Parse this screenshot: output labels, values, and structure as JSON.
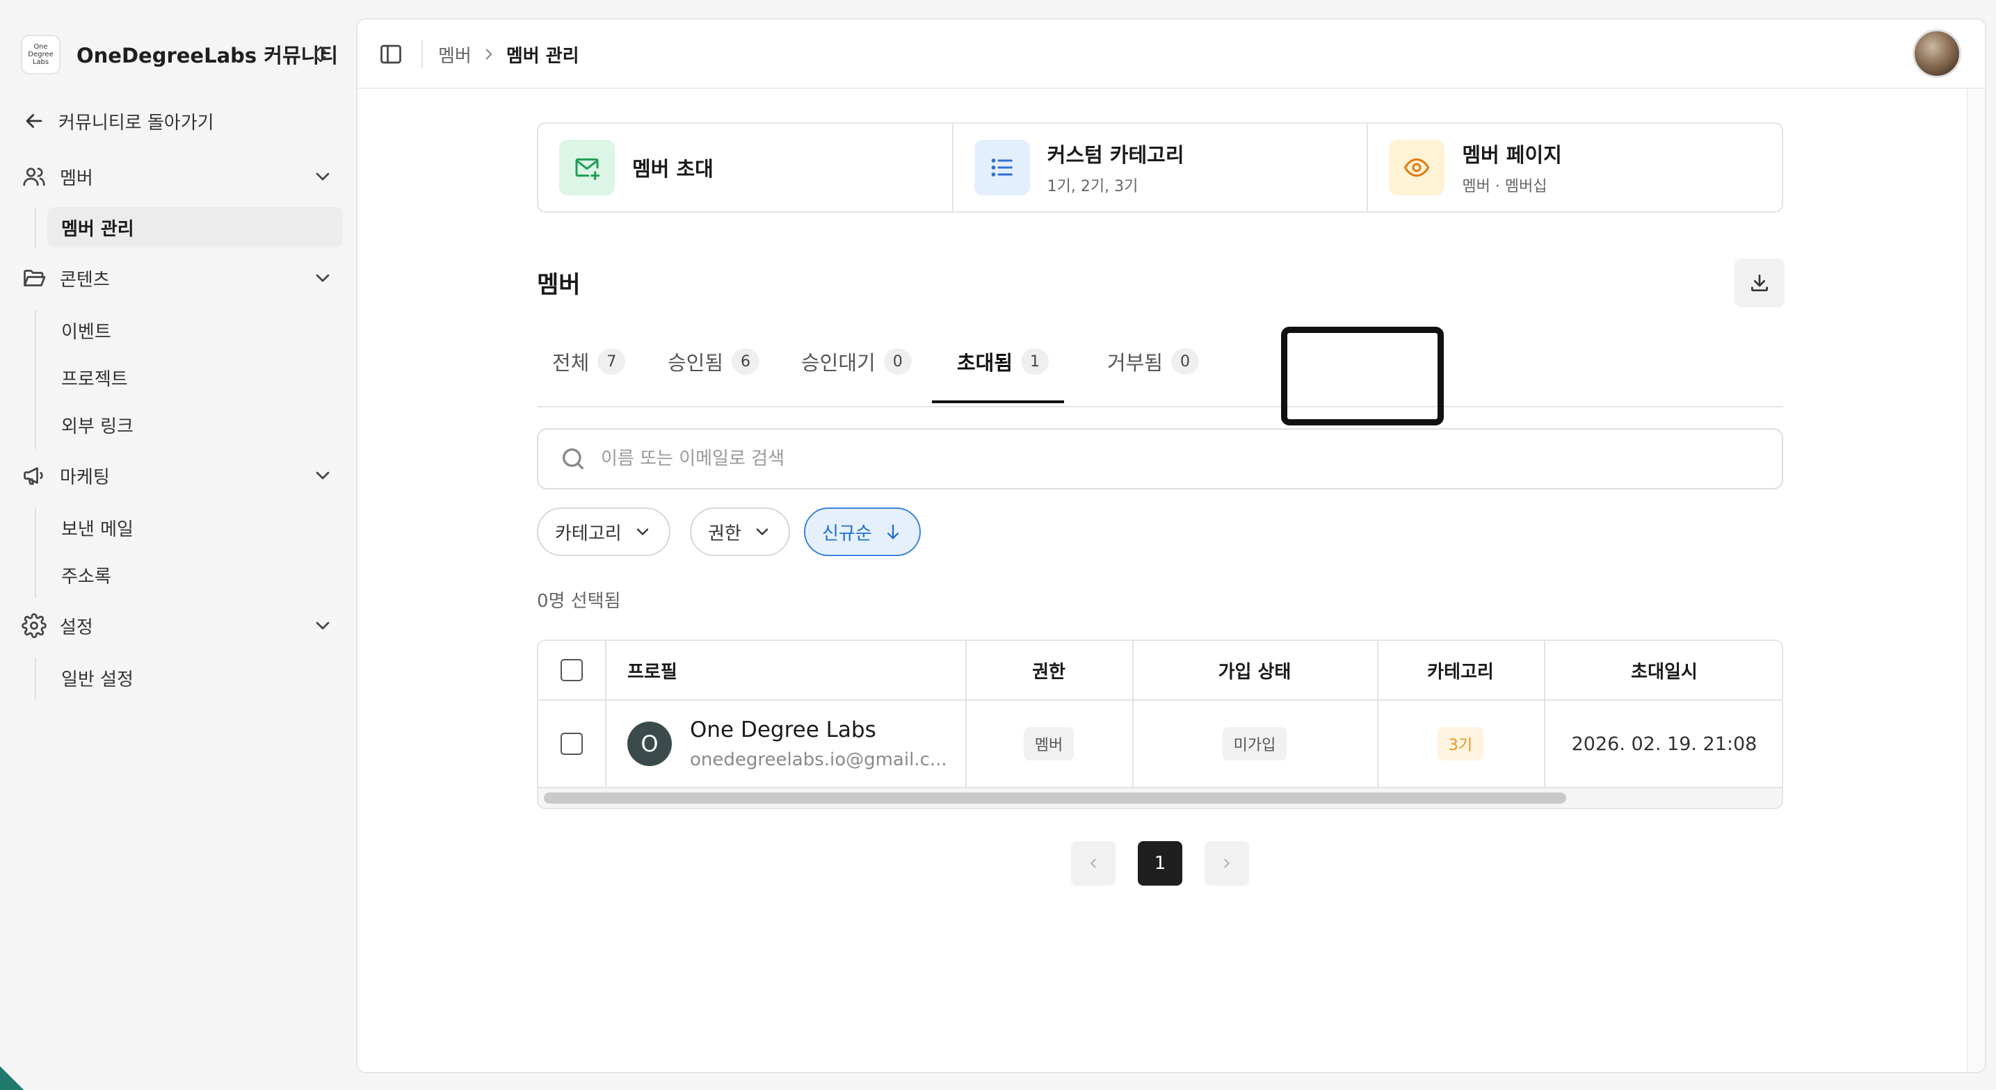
{
  "sidebar": {
    "brand_logo_lines": [
      "One",
      "Degree",
      "Labs"
    ],
    "brand_name": "OneDegreeLabs 커뮤니티",
    "back_label": "커뮤니티로 돌아가기",
    "groups": [
      {
        "label": "멤버",
        "icon": "users-icon",
        "items": [
          "멤버 관리"
        ]
      },
      {
        "label": "콘텐츠",
        "icon": "folder-icon",
        "items": [
          "이벤트",
          "프로젝트",
          "외부 링크"
        ]
      },
      {
        "label": "마케팅",
        "icon": "megaphone-icon",
        "items": [
          "보낸 메일",
          "주소록"
        ]
      },
      {
        "label": "설정",
        "icon": "gear-icon",
        "items": [
          "일반 설정"
        ]
      }
    ],
    "active_item": "멤버 관리"
  },
  "topbar": {
    "breadcrumb": [
      "멤버",
      "멤버 관리"
    ]
  },
  "cards": [
    {
      "title": "멤버 초대",
      "subtitle": "",
      "icon": "mail-plus-icon",
      "bg": "#dcf5e6",
      "fg": "#1f9d55"
    },
    {
      "title": "커스텀 카테고리",
      "subtitle": "1기, 2기, 3기",
      "icon": "list-icon",
      "bg": "#e3effc",
      "fg": "#2f6fd6"
    },
    {
      "title": "멤버 페이지",
      "subtitle": "멤버 · 멤버십",
      "icon": "eye-icon",
      "bg": "#fff3d6",
      "fg": "#e07a10"
    }
  ],
  "section_title": "멤버",
  "tabs": [
    {
      "label": "전체",
      "count": "7"
    },
    {
      "label": "승인됨",
      "count": "6"
    },
    {
      "label": "승인대기",
      "count": "0"
    },
    {
      "label": "초대됨",
      "count": "1"
    },
    {
      "label": "거부됨",
      "count": "0"
    }
  ],
  "active_tab": "초대됨",
  "search": {
    "placeholder": "이름 또는 이메일로 검색",
    "value": ""
  },
  "filters": [
    {
      "label": "카테고리",
      "icon": "chevron-down-icon"
    },
    {
      "label": "권한",
      "icon": "chevron-down-icon"
    },
    {
      "label": "신규순",
      "icon": "arrow-down-icon"
    }
  ],
  "selected_count": "0명 선택됨",
  "table": {
    "headers": [
      "프로필",
      "권한",
      "가입 상태",
      "카테고리",
      "초대일시"
    ],
    "rows": [
      {
        "avatar_letter": "O",
        "name": "One Degree Labs",
        "email": "onedegreelabs.io@gmail.c...",
        "role": "멤버",
        "status": "미가입",
        "category": "3기",
        "invited_at": "2026. 02. 19. 21:08"
      }
    ]
  },
  "pagination": {
    "current": "1"
  },
  "colors": {
    "accent_blue": "#1d6fd8",
    "category_orange": "#e69520",
    "dark": "#1f1f1f"
  }
}
